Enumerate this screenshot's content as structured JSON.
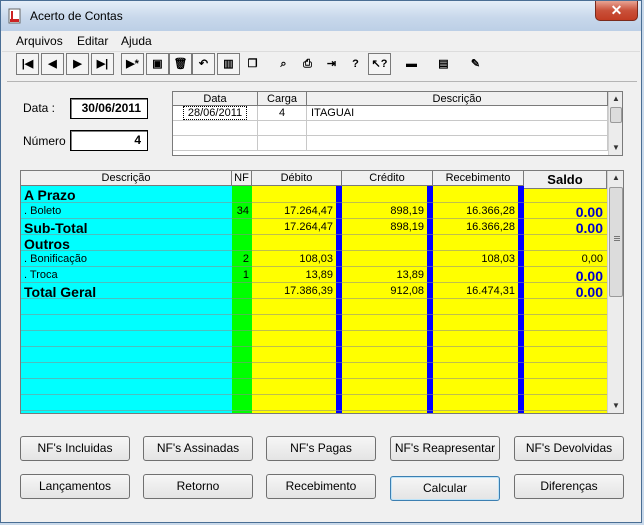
{
  "window": {
    "title": "Acerto de Contas",
    "close_label": "✕"
  },
  "menu": [
    "Arquivos",
    "Editar",
    "Ajuda"
  ],
  "toolbar": [
    {
      "name": "first-record-button",
      "glyph": "|◀"
    },
    {
      "name": "prev-record-button",
      "glyph": "◀"
    },
    {
      "name": "next-record-button",
      "glyph": "▶"
    },
    {
      "name": "last-record-button",
      "glyph": "▶|"
    },
    {
      "name": "new-record-button",
      "glyph": "▶*"
    },
    {
      "name": "save-button",
      "glyph": "▣"
    },
    {
      "name": "delete-button",
      "glyph": "🗑"
    },
    {
      "name": "undo-button",
      "glyph": "↶"
    },
    {
      "name": "books-button",
      "glyph": "▥"
    },
    {
      "name": "copy-button",
      "glyph": "❐"
    },
    {
      "name": "find-button",
      "glyph": "⌕"
    },
    {
      "name": "print-button",
      "glyph": "⎙"
    },
    {
      "name": "exit-door-button",
      "glyph": "⇥"
    },
    {
      "name": "help-button",
      "glyph": "?"
    },
    {
      "name": "context-help-button",
      "glyph": "↖?"
    },
    {
      "name": "keyboard-button",
      "glyph": "▬"
    },
    {
      "name": "notes-button",
      "glyph": "▤"
    },
    {
      "name": "tools-button",
      "glyph": "✎"
    }
  ],
  "form": {
    "date_label": "Data :",
    "date_value": "30/06/2011",
    "number_label": "Número :",
    "number_value": "4"
  },
  "loads_grid": {
    "headers": [
      "Data",
      "Carga",
      "Descrição"
    ],
    "rows": [
      {
        "data": "28/06/2011",
        "carga": "4",
        "descricao": "ITAGUAI"
      }
    ]
  },
  "summary_grid": {
    "headers": {
      "descricao": "Descrição",
      "nf": "NF",
      "debito": "Débito",
      "credito": "Crédito",
      "recebimento": "Recebimento",
      "saldo": "Saldo"
    },
    "rows": [
      {
        "descricao": "A Prazo",
        "nf": "",
        "debito": "",
        "credito": "",
        "recebimento": "",
        "saldo": "",
        "style": "group"
      },
      {
        "descricao": ".  Boleto",
        "nf": "34",
        "debito": "17.264,47",
        "credito": "898,19",
        "recebimento": "16.366,28",
        "saldo": "0.00",
        "style": "item-bold-saldo"
      },
      {
        "descricao": "Sub-Total",
        "nf": "",
        "debito": "17.264,47",
        "credito": "898,19",
        "recebimento": "16.366,28",
        "saldo": "0.00",
        "style": "total"
      },
      {
        "descricao": "Outros",
        "nf": "",
        "debito": "",
        "credito": "",
        "recebimento": "",
        "saldo": "",
        "style": "group"
      },
      {
        "descricao": ".  Bonificação",
        "nf": "2",
        "debito": "108,03",
        "credito": "",
        "recebimento": "108,03",
        "saldo": "0,00",
        "style": "item"
      },
      {
        "descricao": ".  Troca",
        "nf": "1",
        "debito": "13,89",
        "credito": "13,89",
        "recebimento": "",
        "saldo": "0.00",
        "style": "item-bold-saldo"
      },
      {
        "descricao": "Total Geral",
        "nf": "",
        "debito": "17.386,39",
        "credito": "912,08",
        "recebimento": "16.474,31",
        "saldo": "0.00",
        "style": "total"
      }
    ],
    "colors": {
      "descricao": "#00ffff",
      "nf": "#00ff00",
      "values": "#ffff00",
      "separator": "#0000ff"
    }
  },
  "buttons_row1": [
    {
      "name": "nfs-incluidas-button",
      "label": "NF's Incluidas"
    },
    {
      "name": "nfs-assinadas-button",
      "label": "NF's Assinadas"
    },
    {
      "name": "nfs-pagas-button",
      "label": "NF's Pagas"
    },
    {
      "name": "nfs-reapresentar-button",
      "label": "NF's Reapresentar"
    },
    {
      "name": "nfs-devolvidas-button",
      "label": "NF's Devolvidas"
    }
  ],
  "buttons_row2": [
    {
      "name": "lancamentos-button",
      "label": "Lançamentos"
    },
    {
      "name": "retorno-button",
      "label": "Retorno"
    },
    {
      "name": "recebimento-button",
      "label": "Recebimento"
    },
    {
      "name": "calcular-button",
      "label": "Calcular"
    },
    {
      "name": "diferencas-button",
      "label": "Diferenças"
    }
  ]
}
